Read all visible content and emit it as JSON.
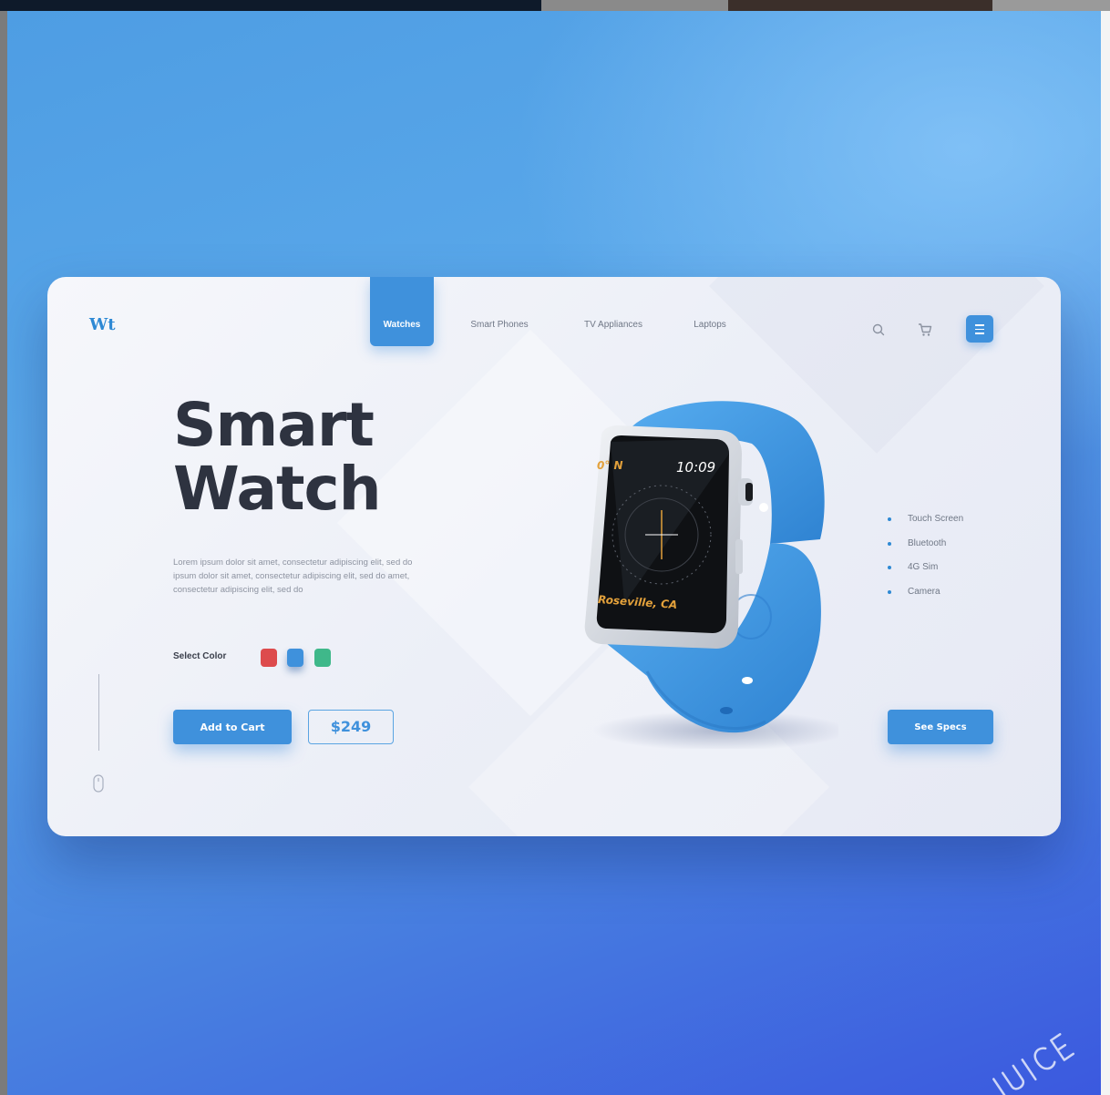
{
  "brand": {
    "logo": "Wt"
  },
  "nav": {
    "items": [
      "Watches",
      "Smart Phones",
      "TV Appliances",
      "Laptops"
    ],
    "active_index": 0
  },
  "header_icons": [
    "search-icon",
    "cart-icon",
    "menu-icon"
  ],
  "hero": {
    "title_line1": "Smart",
    "title_line2": "Watch",
    "description": "Lorem ipsum dolor sit amet, consectetur adipiscing elit, sed do ipsum dolor sit amet, consectetur adipiscing elit, sed do  amet, consectetur adipiscing elit, sed do"
  },
  "color_select": {
    "label": "Select Color",
    "options": [
      {
        "name": "red",
        "color": "#dd4b4d"
      },
      {
        "name": "blue",
        "color": "#3f91dc",
        "selected": true
      },
      {
        "name": "green",
        "color": "#3fb88a"
      }
    ]
  },
  "actions": {
    "add_to_cart": "Add to Cart",
    "price": "$249",
    "see_specs": "See Specs"
  },
  "product": {
    "watch_face": {
      "heading": "0° N",
      "time": "10:09",
      "location": "Roseville, CA"
    },
    "band_color": "#3f97de"
  },
  "features": [
    "Touch Screen",
    "Bluetooth",
    "4G Sim",
    "Camera"
  ],
  "watermark": "JUICE",
  "colors": {
    "accent": "#3f91dc",
    "title": "#2e3340",
    "background_top": "#5aa8ea",
    "background_bottom": "#3b59df"
  }
}
